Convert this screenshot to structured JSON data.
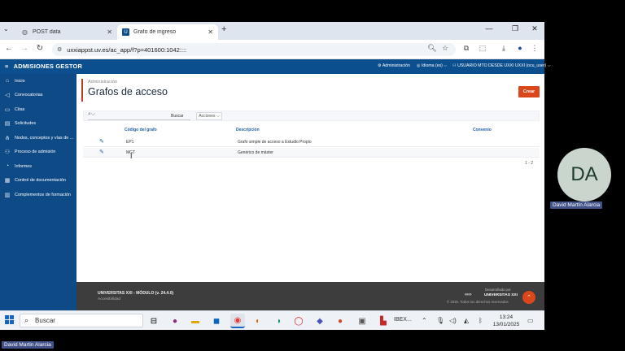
{
  "browser": {
    "tabs": [
      {
        "title": "POST data",
        "active": false
      },
      {
        "title": "Grafo de ingreso",
        "active": true
      }
    ],
    "url": "uxxiappst.uv.es/ac_app/f?p=401600:1042::::"
  },
  "app": {
    "brand": "ADMISIONES GESTOR",
    "top_menu": {
      "admin": "Administración",
      "idioma": "Idioma (es)",
      "user": "USUARIO MTO DESDE UXXI UXXI (ocu_user)"
    },
    "sidebar": [
      {
        "label": "Inicio",
        "icon": "home-icon"
      },
      {
        "label": "Convocatorias",
        "icon": "megaphone-icon"
      },
      {
        "label": "Citas",
        "icon": "calendar-icon"
      },
      {
        "label": "Solicitudes",
        "icon": "document-icon"
      },
      {
        "label": "Nodos, conceptos y vías de ...",
        "icon": "tree-icon"
      },
      {
        "label": "Proceso de admisión",
        "icon": "users-icon"
      },
      {
        "label": "Informes",
        "icon": "chart-icon"
      },
      {
        "label": "Control de documentación",
        "icon": "table-icon"
      },
      {
        "label": "Complementos de formación",
        "icon": "book-icon"
      }
    ],
    "page": {
      "breadcrumb": "Administración",
      "title": "Grafos de acceso",
      "create_label": "Crear"
    },
    "filter": {
      "placeholder": "",
      "search_label": "Buscar",
      "actions_label": "Acciones ⌵"
    },
    "table": {
      "headers": [
        "Código del grafo",
        "Descripción",
        "Convenio"
      ],
      "rows": [
        {
          "code": "EP1",
          "description": "Grafo simple de acceso a Estudio Propio",
          "convenio": ""
        },
        {
          "code": "MGT",
          "description": "Genérico de máster",
          "convenio": ""
        }
      ],
      "pagination": "1 - 2"
    },
    "footer": {
      "line1": "UNIVERSITAS XXI - MÓDULO (v. 24.4.0)",
      "line2": "Accesibilidad",
      "developed_by": "Desarrollado por",
      "logo_text": "UNIVERSITAS XXI",
      "copyright": "© 2025. Todos los derechos reservados"
    }
  },
  "taskbar": {
    "search_placeholder": "Buscar",
    "ibex_label": "IBEX...",
    "time": "13:24",
    "date": "13/01/2025"
  },
  "video": {
    "initials": "DA",
    "participant_name": "David Martín Alarcia",
    "self_name": "David Martin Alarcia"
  },
  "colors": {
    "brand_blue": "#0b4f8f",
    "sidebar_blue": "#0d4a86",
    "accent_orange": "#d9471b",
    "link_blue": "#1e5fa8"
  }
}
